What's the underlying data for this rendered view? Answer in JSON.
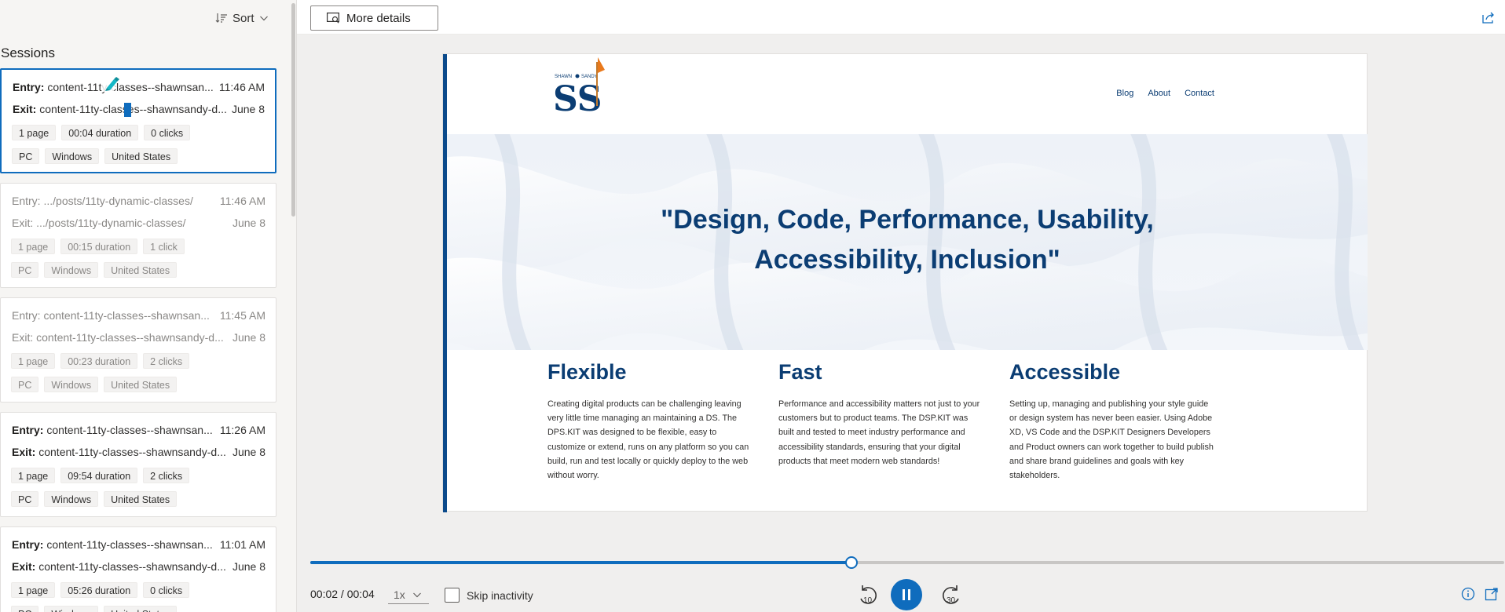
{
  "sidebar": {
    "sort_label": "Sort",
    "title": "Sessions",
    "sessions": [
      {
        "entry_label": "Entry:",
        "entry": "content-11ty-classes--shawnsan...",
        "entry_time": "11:46 AM",
        "exit_label": "Exit:",
        "exit": "content-11ty-classes--shawnsandy-d...",
        "exit_date": "June 8",
        "pages": "1 page",
        "duration": "00:04 duration",
        "clicks": "0 clicks",
        "device": "PC",
        "os": "Windows",
        "country": "United States"
      },
      {
        "entry_label": "Entry:",
        "entry": ".../posts/11ty-dynamic-classes/",
        "entry_time": "11:46 AM",
        "exit_label": "Exit:",
        "exit": ".../posts/11ty-dynamic-classes/",
        "exit_date": "June 8",
        "pages": "1 page",
        "duration": "00:15 duration",
        "clicks": "1 click",
        "device": "PC",
        "os": "Windows",
        "country": "United States"
      },
      {
        "entry_label": "Entry:",
        "entry": "content-11ty-classes--shawnsan...",
        "entry_time": "11:45 AM",
        "exit_label": "Exit:",
        "exit": "content-11ty-classes--shawnsandy-d...",
        "exit_date": "June 8",
        "pages": "1 page",
        "duration": "00:23 duration",
        "clicks": "2 clicks",
        "device": "PC",
        "os": "Windows",
        "country": "United States"
      },
      {
        "entry_label": "Entry:",
        "entry": "content-11ty-classes--shawnsan...",
        "entry_time": "11:26 AM",
        "exit_label": "Exit:",
        "exit": "content-11ty-classes--shawnsandy-d...",
        "exit_date": "June 8",
        "pages": "1 page",
        "duration": "09:54 duration",
        "clicks": "2 clicks",
        "device": "PC",
        "os": "Windows",
        "country": "United States"
      },
      {
        "entry_label": "Entry:",
        "entry": "content-11ty-classes--shawnsan...",
        "entry_time": "11:01 AM",
        "exit_label": "Exit:",
        "exit": "content-11ty-classes--shawnsandy-d...",
        "exit_date": "June 8",
        "pages": "1 page",
        "duration": "05:26 duration",
        "clicks": "0 clicks",
        "device": "PC",
        "os": "Windows",
        "country": "United States"
      }
    ]
  },
  "toolbar": {
    "more_details_label": "More details"
  },
  "preview": {
    "logo_text": "SHAWN SANDY",
    "nav": [
      "Blog",
      "About",
      "Contact"
    ],
    "hero_quote": "\"Design, Code, Performance, Usability, Accessibility, Inclusion\"",
    "features": [
      {
        "title": "Flexible",
        "body": "Creating digital products can be challenging leaving very little time managing an maintaining a DS. The DPS.KIT was designed to be flexible, easy to customize or extend, runs on any platform so you can build, run and test locally or quickly deploy to the web without worry."
      },
      {
        "title": "Fast",
        "body": "Performance and accessibility matters not just to your customers but to product teams. The DSP.KIT was built and tested to meet industry performance and accessibility standards, ensuring that your digital products that meet modern web standards!"
      },
      {
        "title": "Accessible",
        "body": "Setting up, managing and publishing your style guide or design system has never been easier. Using Adobe XD, VS Code and the DSP.KIT Designers Developers and Product owners can work together to build publish and share brand guidelines and goals with key stakeholders."
      }
    ],
    "accent_color": "#0b4a8b",
    "heading_color": "#0b3d73"
  },
  "player": {
    "time": "00:02 / 00:04",
    "progress": 0.453,
    "speed": "1x",
    "skip_inactivity_label": "Skip inactivity",
    "rewind_seconds": "10",
    "forward_seconds": "30",
    "accent_color": "#0f6cbd"
  }
}
